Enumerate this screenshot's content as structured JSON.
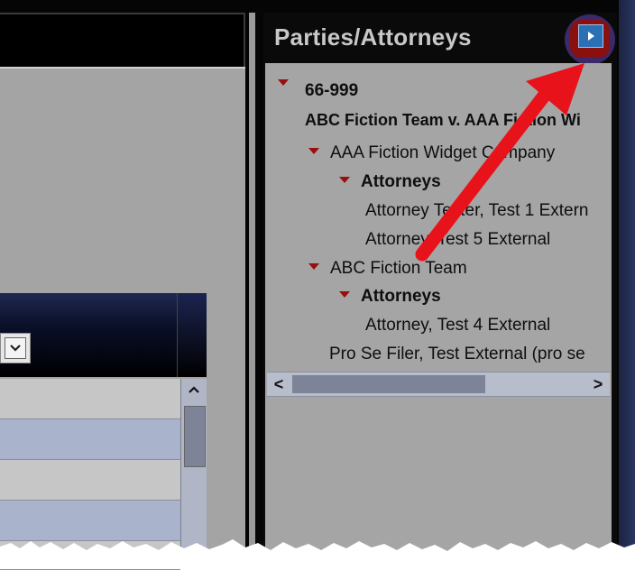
{
  "panel": {
    "title": "Parties/Attorneys",
    "collapse_button_icon": "arrow-right-icon"
  },
  "tree": {
    "case_number": "66-999",
    "case_title": "ABC Fiction Team v. AAA Fiction Wi",
    "parties": [
      {
        "name": "AAA Fiction Widget Company",
        "attorneys_label": "Attorneys",
        "attorneys": [
          "Attorney Tester, Test 1 Extern",
          "Attorney, Test 5 External"
        ]
      },
      {
        "name": "ABC Fiction Team",
        "attorneys_label": "Attorneys",
        "attorneys": [
          "Attorney, Test 4 External"
        ]
      }
    ],
    "pro_se": "Pro Se Filer, Test External (pro se"
  },
  "scrollbar": {
    "left_arrow": "<",
    "right_arrow": ">"
  },
  "grid": {
    "dropdown_icon": "chevron-down-icon",
    "scroll_up_icon": "chevron-up-icon"
  },
  "annotation": {
    "arrow_color": "#e8121b"
  }
}
